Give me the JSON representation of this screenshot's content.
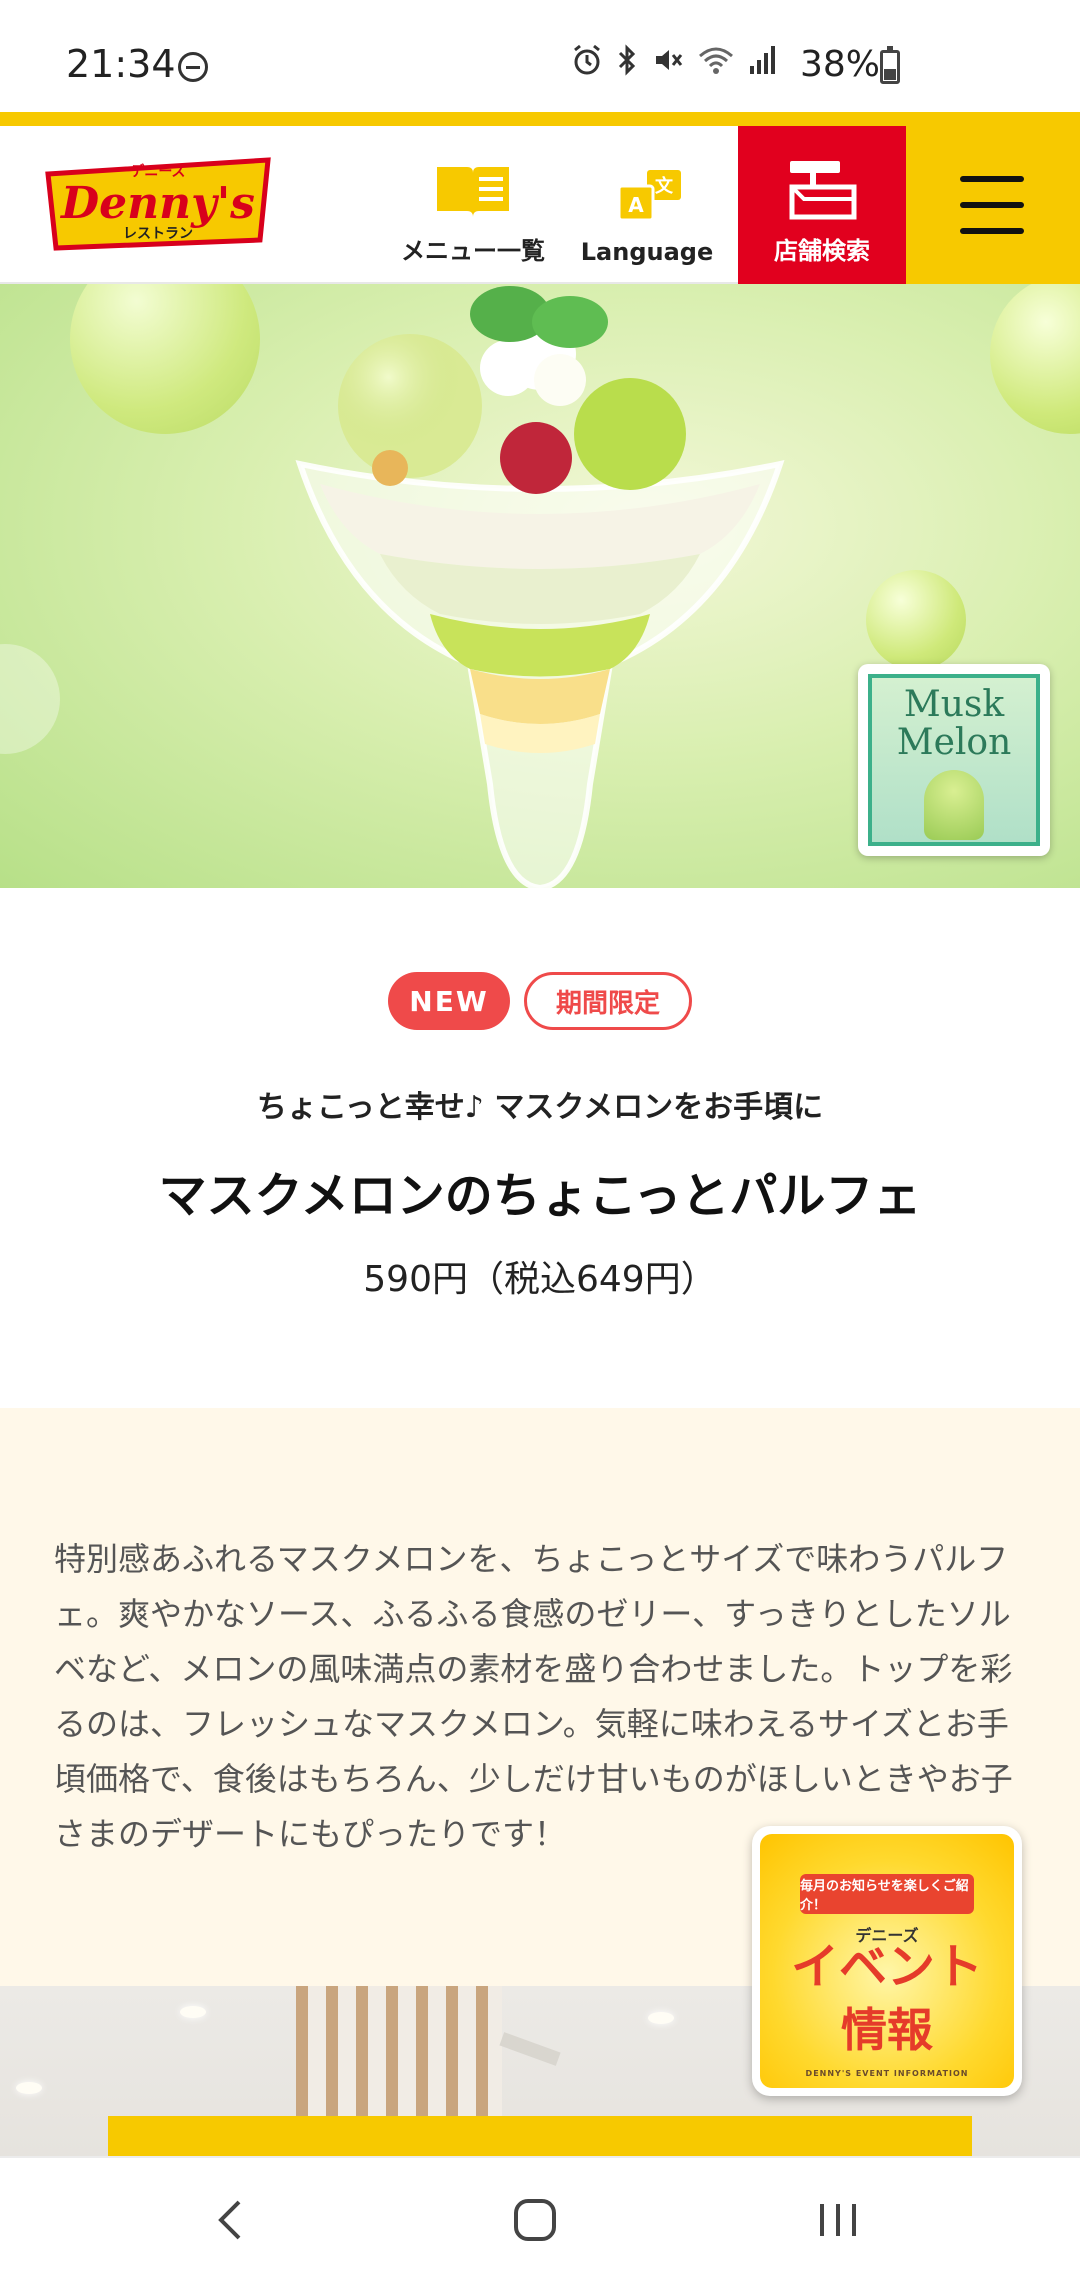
{
  "status_bar": {
    "time": "21:34",
    "battery": "38%",
    "icons": [
      "alarm-icon",
      "bluetooth-icon",
      "mute-icon",
      "wifi-icon",
      "signal-icon"
    ]
  },
  "header": {
    "logo_top": "デニーズ",
    "logo_main": "Denny's",
    "logo_bottom": "レストラン",
    "menu_label": "メニュー一覧",
    "language_label": "Language",
    "store_label": "店舗検索",
    "colors": {
      "yellow": "#f7c900",
      "red": "#e1001e"
    }
  },
  "hero": {
    "badge_title_line1": "Musk",
    "badge_title_line2": "Melon"
  },
  "product": {
    "tag_new": "NEW",
    "tag_limited": "期間限定",
    "subtitle": "ちょこっと幸せ♪ マスクメロンをお手頃に",
    "title": "マスクメロンのちょこっとパルフェ",
    "price": "590円（税込649円）"
  },
  "description": {
    "text": "特別感あふれるマスクメロンを、ちょこっとサイズで味わうパルフェ。爽やかなソース、ふるふる食感のゼリー、すっきりとしたソルベなど、メロンの風味満点の素材を盛り合わせました。トップを彩るのは、フレッシュなマスクメロン。気軽に味わえるサイズとお手頃価格で、食後はもちろん、少しだけ甘いものがほしいときやお子さまのデザートにもぴったりです！"
  },
  "event_banner": {
    "ribbon": "毎月のお知らせを楽しくご紹介！",
    "brand": "デニーズ",
    "title": "イベント",
    "subtitle": "情報",
    "english": "DENNY'S EVENT INFORMATION"
  },
  "navbar": {
    "buttons": [
      "back-button",
      "home-button",
      "recents-button"
    ]
  }
}
